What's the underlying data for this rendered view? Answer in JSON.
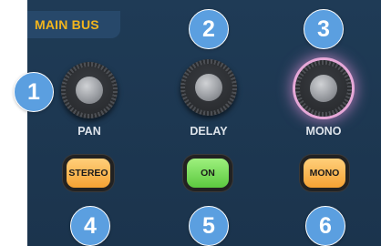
{
  "section": {
    "title": "MAIN BUS"
  },
  "knobs": [
    {
      "label": "PAN",
      "highlighted": false
    },
    {
      "label": "DELAY",
      "highlighted": false
    },
    {
      "label": "MONO",
      "highlighted": true
    }
  ],
  "buttons": [
    {
      "label": "STEREO",
      "color": "#f5a233"
    },
    {
      "label": "ON",
      "color": "#5cc93f"
    },
    {
      "label": "MONO",
      "color": "#f5a233"
    }
  ],
  "callouts": [
    "1",
    "2",
    "3",
    "4",
    "5",
    "6"
  ],
  "colors": {
    "panel": "#1f3b56",
    "title": "#f2b51d",
    "callout": "#5b9fe0",
    "knob_glow": "#e7a8d8"
  }
}
